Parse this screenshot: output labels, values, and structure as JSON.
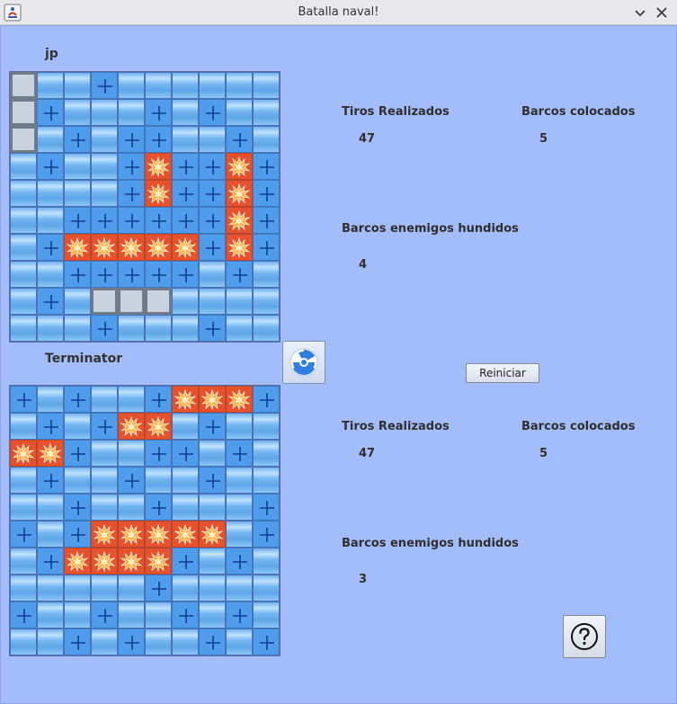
{
  "window": {
    "title": "Batalla naval!"
  },
  "players": [
    {
      "name": "jp",
      "grid": [
        "SWWMWWWWWW",
        "SMWWWMWMWW",
        "SWMWMMWWMW",
        "WMWWMHMMHM",
        "WWWWMHMMHM",
        "WWMMMMMMHM",
        "WMHHHHHMHM",
        "WWMMMMMWMW",
        "WMWSSSWWWW",
        "WWWMWWWMWW"
      ],
      "stats": {
        "shots_label": "Tiros Realizados",
        "shots_value": "47",
        "placed_label": "Barcos colocados",
        "placed_value": "5",
        "sunk_label": "Barcos enemigos hundidos",
        "sunk_value": "4"
      }
    },
    {
      "name": "Terminator",
      "grid": [
        "MWMWWMHHHM",
        "WMWMHHWMWW",
        "HHMWWMMWMW",
        "WMWWMWWMWW",
        "WWMWWMWWWM",
        "MWMHHHHHWM",
        "WMHHHHMWMW",
        "WWWWWMWWWW",
        "MWWMWWMWMW",
        "WWMWMWWMWM"
      ],
      "stats": {
        "shots_label": "Tiros Realizados",
        "shots_value": "47",
        "placed_label": "Barcos colocados",
        "placed_value": "5",
        "sunk_label": "Barcos enemigos hundidos",
        "sunk_value": "3"
      }
    }
  ],
  "legend": {
    "W": "water",
    "M": "miss",
    "H": "hit",
    "S": "ship"
  },
  "controls": {
    "reset_label": "Reiniciar",
    "attack_icon": "radiation-icon",
    "help_icon": "help-icon"
  }
}
